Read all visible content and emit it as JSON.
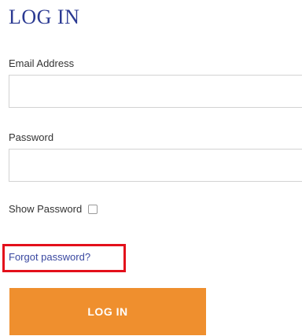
{
  "login_form": {
    "title": "LOG IN",
    "email": {
      "label": "Email Address",
      "value": "",
      "placeholder": ""
    },
    "password": {
      "label": "Password",
      "value": "",
      "placeholder": ""
    },
    "show_password": {
      "label": "Show Password",
      "checked": false
    },
    "forgot_password_link": "Forgot password?",
    "submit_button": "LOG IN"
  },
  "colors": {
    "title": "#2b3a92",
    "link": "#3a48a0",
    "button_background": "#ef8f2e",
    "highlight_border": "#e3101b"
  }
}
